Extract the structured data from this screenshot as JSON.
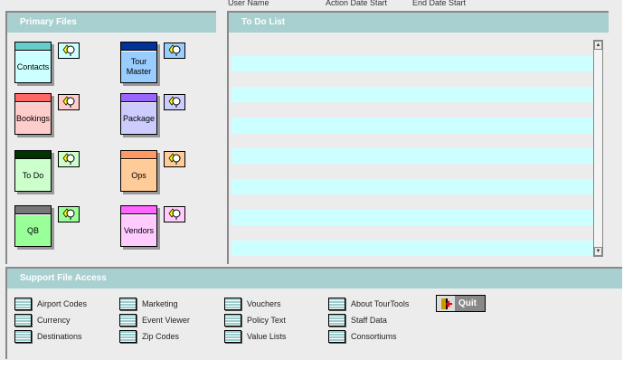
{
  "header": {
    "user_name": "User Name",
    "action_date_start": "Action Date Start",
    "end_date_start": "End Date Start"
  },
  "primary_files": {
    "title": "Primary Files",
    "cards": [
      {
        "label": "Contacts",
        "top": "#66cccc",
        "body": "#ccffff"
      },
      {
        "label": "Tour Master",
        "top": "#003399",
        "body": "#99ccff"
      },
      {
        "label": "Bookings",
        "top": "#ff6666",
        "body": "#ffcccc"
      },
      {
        "label": "Package",
        "top": "#9966ff",
        "body": "#ccccff"
      },
      {
        "label": "To Do",
        "top": "#003300",
        "body": "#ccffcc"
      },
      {
        "label": "Ops",
        "top": "#ff9966",
        "body": "#ffcc99"
      },
      {
        "label": "QB",
        "top": "#777777",
        "body": "#99ff99"
      },
      {
        "label": "Vendors",
        "top": "#ff66ff",
        "body": "#ffccff"
      }
    ]
  },
  "todo": {
    "title": "To Do List"
  },
  "support": {
    "title": "Support File Access",
    "items": [
      "Airport Codes",
      "Currency",
      "Destinations",
      "Marketing",
      "Event Viewer",
      "Zip Codes",
      "Vouchers",
      "Policy Text",
      "Value Lists",
      "About TourTools",
      "Staff Data",
      "Consortiums"
    ],
    "quit": "Quit"
  }
}
